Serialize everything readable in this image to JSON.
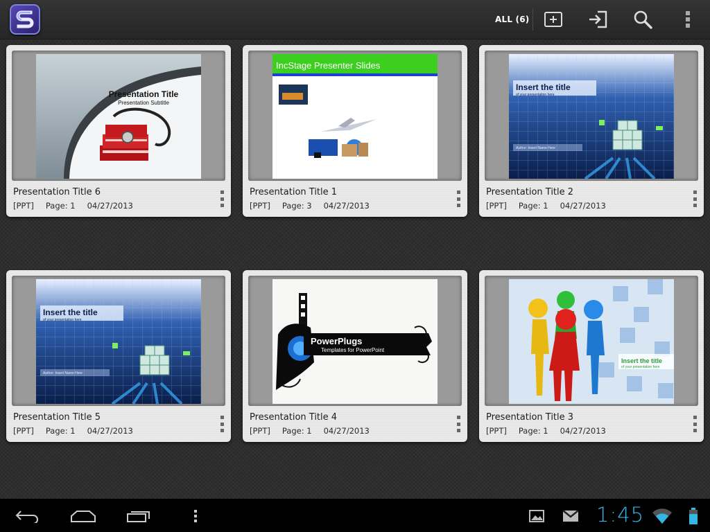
{
  "actionbar": {
    "app_icon": "app-logo-s-icon",
    "filter_label": "ALL (6)",
    "icons": [
      "add-icon",
      "import-icon",
      "search-icon",
      "overflow-menu-icon"
    ]
  },
  "presentations": [
    {
      "title": "Presentation Title 6",
      "type": "[PPT]",
      "page": "Page: 1",
      "date": "04/27/2013",
      "thumb": {
        "heading": "Presentation Title",
        "subheading": "Presentation Subtitle"
      }
    },
    {
      "title": "Presentation Title 1",
      "type": "[PPT]",
      "page": "Page: 3",
      "date": "04/27/2013",
      "thumb": {
        "heading": "IncStage Presenter Slides"
      }
    },
    {
      "title": "Presentation Title 2",
      "type": "[PPT]",
      "page": "Page: 1",
      "date": "04/27/2013",
      "thumb": {
        "heading": "Insert the title",
        "subheading": "of your presentation here",
        "footer": "Author: Insert Name Here"
      }
    },
    {
      "title": "Presentation Title 5",
      "type": "[PPT]",
      "page": "Page: 1",
      "date": "04/27/2013",
      "thumb": {
        "heading": "Insert the title",
        "subheading": "of your presentation here",
        "footer": "Author: Insert Name Here"
      }
    },
    {
      "title": "Presentation Title 4",
      "type": "[PPT]",
      "page": "Page: 1",
      "date": "04/27/2013",
      "thumb": {
        "heading": "PowerPlugs",
        "subheading": "Templates for PowerPoint"
      }
    },
    {
      "title": "Presentation Title 3",
      "type": "[PPT]",
      "page": "Page: 1",
      "date": "04/27/2013",
      "thumb": {
        "heading": "Insert the title",
        "subheading": "of your presentation here"
      }
    }
  ],
  "systembar": {
    "nav_icons": [
      "back-icon",
      "home-icon",
      "recent-apps-icon",
      "menu-icon"
    ],
    "notification_icons": [
      "gallery-notification-icon",
      "gmail-notification-icon"
    ],
    "clock": "1:45",
    "status_icons": [
      "wifi-icon",
      "battery-icon"
    ],
    "accent_color": "#33b5e5"
  }
}
